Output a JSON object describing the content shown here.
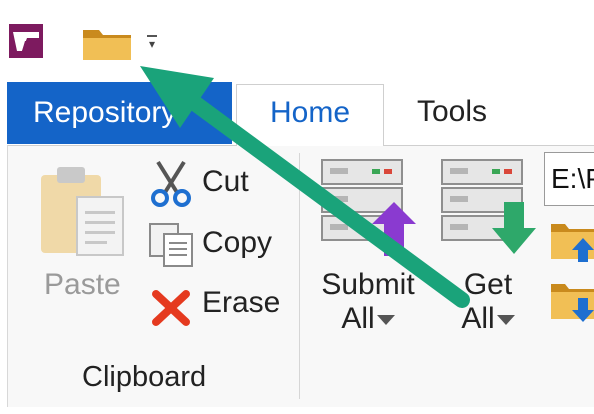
{
  "qat": {
    "more_glyph": "▾"
  },
  "tabs": [
    {
      "label": "Repository",
      "active": false
    },
    {
      "label": "Home",
      "active": true
    },
    {
      "label": "Tools",
      "active": false
    }
  ],
  "clipboard": {
    "paste_label": "Paste",
    "cut_label": "Cut",
    "copy_label": "Copy",
    "erase_label": "Erase",
    "group_label": "Clipboard"
  },
  "repo_actions": {
    "submit_line1": "Submit",
    "submit_line2": "All",
    "get_line1": "Get",
    "get_line2": "All",
    "path_value": "E:\\P"
  },
  "colors": {
    "accent_blue": "#1464c8",
    "logo_purple": "#7d1a5f",
    "annotation_green": "#1aa37a",
    "folder_yellow": "#e8b040",
    "submit_purple": "#8a3ad0",
    "get_green": "#2ea86a",
    "erase_red": "#e53a1f"
  }
}
